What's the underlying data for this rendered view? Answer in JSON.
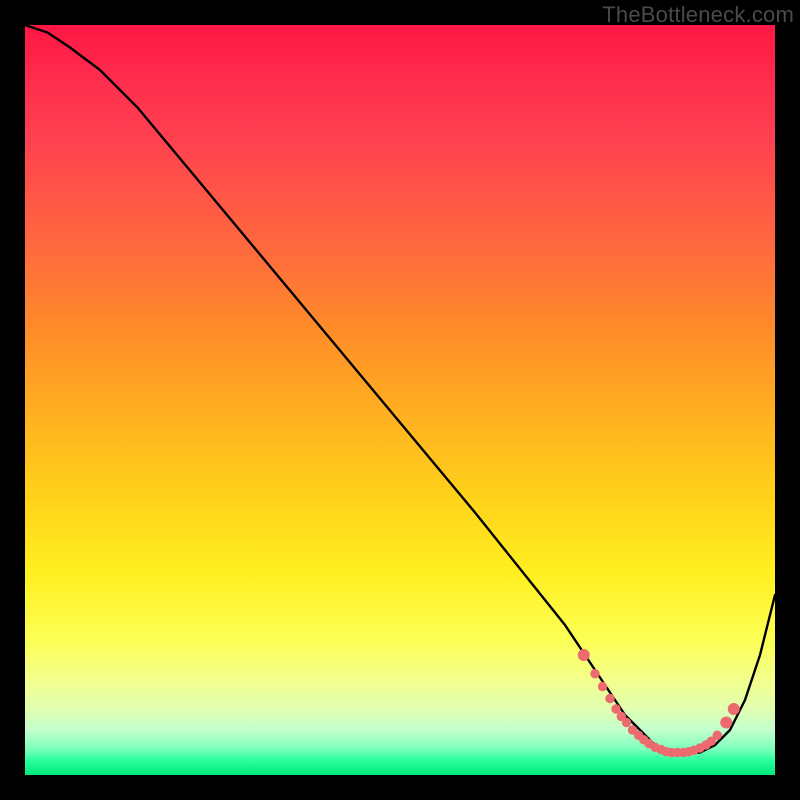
{
  "watermark": "TheBottleneck.com",
  "colors": {
    "curve_stroke": "#000000",
    "dot_fill": "#ed6a6e",
    "dot_stroke": "#ed6a6e"
  },
  "chart_data": {
    "type": "line",
    "title": "",
    "xlabel": "",
    "ylabel": "",
    "xlim": [
      0,
      100
    ],
    "ylim": [
      0,
      100
    ],
    "grid": false,
    "legend": false,
    "series": [
      {
        "name": "bottleneck-curve",
        "x": [
          0,
          3,
          6,
          10,
          15,
          20,
          25,
          30,
          35,
          40,
          45,
          50,
          55,
          60,
          64,
          68,
          72,
          74,
          76,
          78,
          80,
          82,
          84,
          86,
          88,
          90,
          92,
          94,
          96,
          98,
          100
        ],
        "y": [
          100,
          99,
          97,
          94,
          89,
          83,
          77,
          71,
          65,
          59,
          53,
          47,
          41,
          35,
          30,
          25,
          20,
          17,
          14,
          11,
          8,
          6,
          4,
          3,
          3,
          3,
          4,
          6,
          10,
          16,
          24
        ]
      }
    ],
    "highlight_dots": {
      "name": "sweet-spot-dots",
      "x": [
        74.5,
        76.0,
        77.0,
        78.0,
        78.8,
        79.5,
        80.2,
        81.0,
        81.8,
        82.5,
        83.2,
        84.0,
        84.8,
        85.5,
        86.2,
        87.0,
        87.8,
        88.5,
        89.2,
        90.0,
        90.8,
        91.5,
        92.3,
        93.5,
        94.5
      ],
      "y": [
        16.0,
        13.5,
        11.8,
        10.2,
        8.8,
        7.8,
        7.0,
        6.0,
        5.3,
        4.7,
        4.2,
        3.7,
        3.4,
        3.1,
        3.0,
        3.0,
        3.0,
        3.1,
        3.3,
        3.6,
        4.0,
        4.5,
        5.3,
        7.0,
        8.8
      ]
    }
  }
}
